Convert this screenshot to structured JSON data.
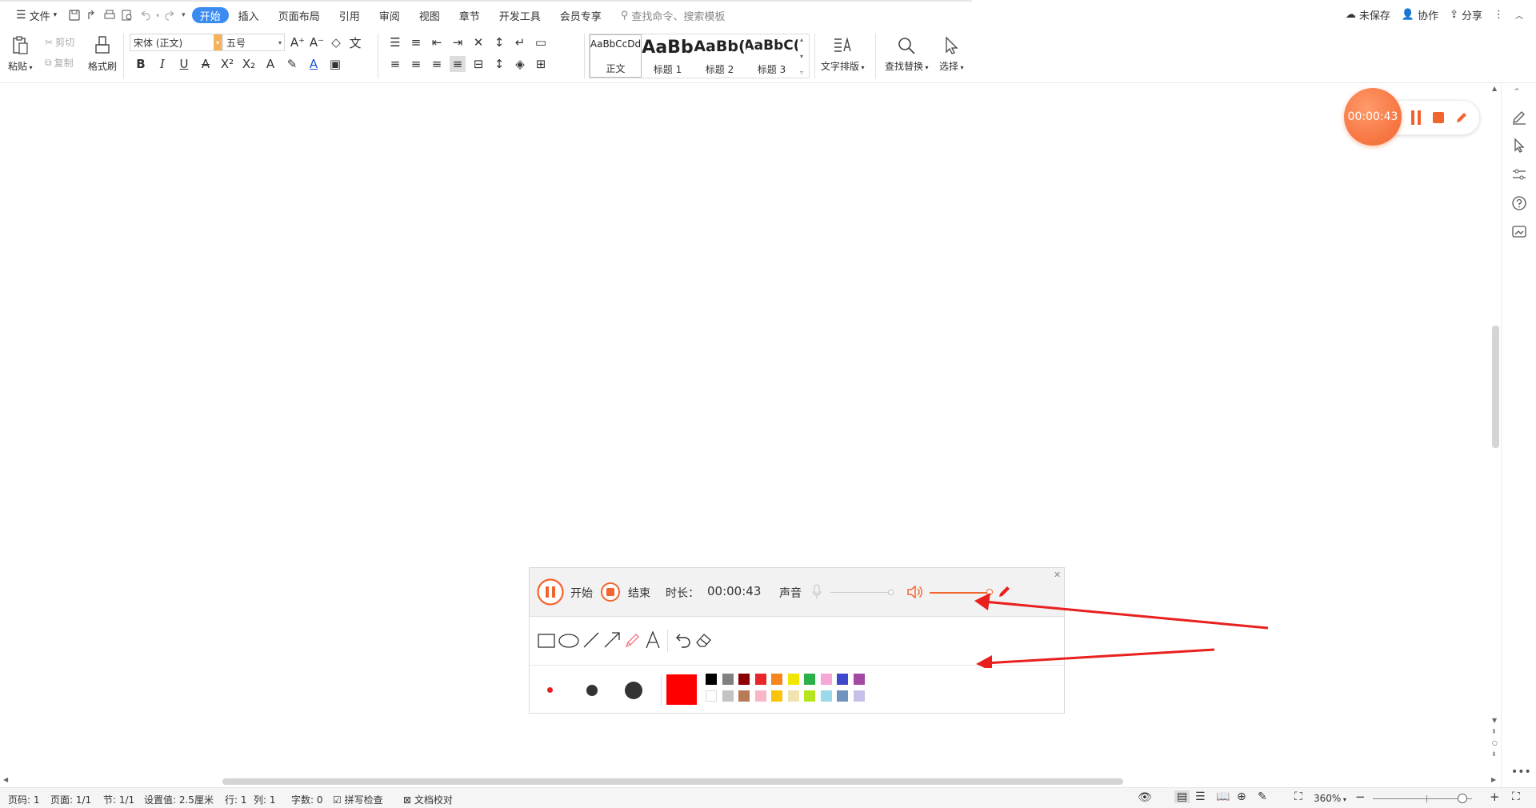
{
  "menu": {
    "file": "文件",
    "tabs": [
      "开始",
      "插入",
      "页面布局",
      "引用",
      "审阅",
      "视图",
      "章节",
      "开发工具",
      "会员专享"
    ],
    "active_tab": "开始",
    "search_placeholder": "查找命令、搜索模板"
  },
  "header_right": {
    "unsaved": "未保存",
    "collab": "协作",
    "share": "分享"
  },
  "ribbon": {
    "paste": "粘贴",
    "cut": "剪切",
    "copy": "复制",
    "format_painter": "格式刷",
    "font_name": "宋体 (正文)",
    "font_size": "五号",
    "styles": [
      {
        "preview": "AaBbCcDd",
        "name": "正文"
      },
      {
        "preview": "AaBb",
        "name": "标题 1"
      },
      {
        "preview": "AaBb(",
        "name": "标题 2"
      },
      {
        "preview": "AaBbC(",
        "name": "标题 3"
      }
    ],
    "text_layout": "文字排版",
    "find_replace": "查找替换",
    "select": "选择"
  },
  "recorder_float": {
    "time": "00:00:43"
  },
  "recorder_panel": {
    "start_label": "开始",
    "end_label": "结束",
    "duration_label": "时长：",
    "duration": "00:00:43",
    "sound_label": "声音",
    "colors_row1": [
      "#000000",
      "#808080",
      "#8b0000",
      "#e8262a",
      "#f7851e",
      "#f2e600",
      "#2cb04a",
      "#f5a8d6",
      "#3f48cc",
      "#a349a4"
    ],
    "colors_row2": [
      "#ffffff",
      "#c3c3c3",
      "#b97a57",
      "#f9b6c4",
      "#fdc20a",
      "#efe4b0",
      "#b5e61d",
      "#99d9ea",
      "#7092be",
      "#c8bfe7"
    ],
    "current_color": "#ff0000"
  },
  "statusbar": {
    "page_code": "页码: 1",
    "page": "页面: 1/1",
    "section": "节: 1/1",
    "setting": "设置值: 2.5厘米",
    "line": "行: 1",
    "col": "列: 1",
    "word_count": "字数: 0",
    "spell_check": "拼写检查",
    "doc_proof": "文档校对",
    "zoom": "360%"
  },
  "colors": {
    "accent": "#3b8cf0",
    "recorder": "#f2642e",
    "annotation_arrow": "#e8201e"
  }
}
